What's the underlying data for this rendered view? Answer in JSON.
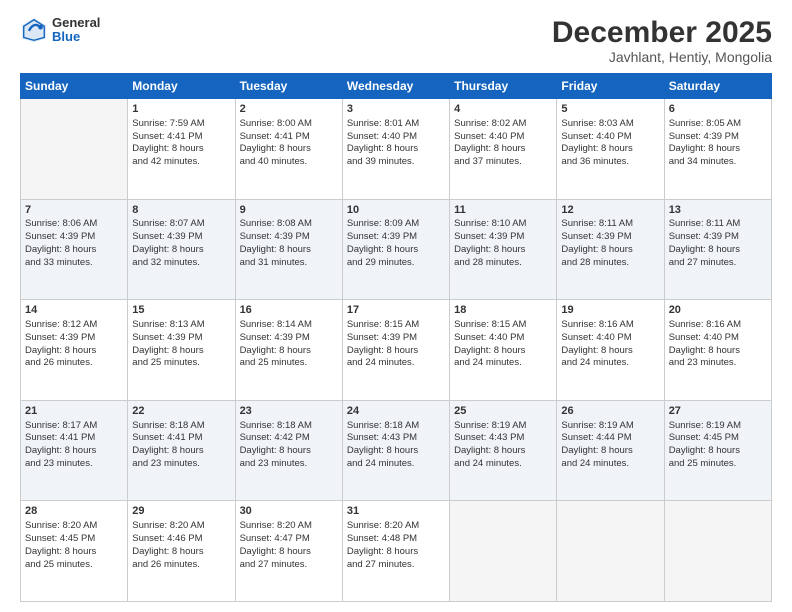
{
  "header": {
    "logo_general": "General",
    "logo_blue": "Blue",
    "month": "December 2025",
    "location": "Javhlant, Hentiy, Mongolia"
  },
  "days_of_week": [
    "Sunday",
    "Monday",
    "Tuesday",
    "Wednesday",
    "Thursday",
    "Friday",
    "Saturday"
  ],
  "weeks": [
    [
      {
        "day": "",
        "empty": true
      },
      {
        "day": "1",
        "sunrise": "Sunrise: 7:59 AM",
        "sunset": "Sunset: 4:41 PM",
        "daylight": "Daylight: 8 hours and 42 minutes."
      },
      {
        "day": "2",
        "sunrise": "Sunrise: 8:00 AM",
        "sunset": "Sunset: 4:41 PM",
        "daylight": "Daylight: 8 hours and 40 minutes."
      },
      {
        "day": "3",
        "sunrise": "Sunrise: 8:01 AM",
        "sunset": "Sunset: 4:40 PM",
        "daylight": "Daylight: 8 hours and 39 minutes."
      },
      {
        "day": "4",
        "sunrise": "Sunrise: 8:02 AM",
        "sunset": "Sunset: 4:40 PM",
        "daylight": "Daylight: 8 hours and 37 minutes."
      },
      {
        "day": "5",
        "sunrise": "Sunrise: 8:03 AM",
        "sunset": "Sunset: 4:40 PM",
        "daylight": "Daylight: 8 hours and 36 minutes."
      },
      {
        "day": "6",
        "sunrise": "Sunrise: 8:05 AM",
        "sunset": "Sunset: 4:39 PM",
        "daylight": "Daylight: 8 hours and 34 minutes."
      }
    ],
    [
      {
        "day": "7",
        "sunrise": "Sunrise: 8:06 AM",
        "sunset": "Sunset: 4:39 PM",
        "daylight": "Daylight: 8 hours and 33 minutes."
      },
      {
        "day": "8",
        "sunrise": "Sunrise: 8:07 AM",
        "sunset": "Sunset: 4:39 PM",
        "daylight": "Daylight: 8 hours and 32 minutes."
      },
      {
        "day": "9",
        "sunrise": "Sunrise: 8:08 AM",
        "sunset": "Sunset: 4:39 PM",
        "daylight": "Daylight: 8 hours and 31 minutes."
      },
      {
        "day": "10",
        "sunrise": "Sunrise: 8:09 AM",
        "sunset": "Sunset: 4:39 PM",
        "daylight": "Daylight: 8 hours and 29 minutes."
      },
      {
        "day": "11",
        "sunrise": "Sunrise: 8:10 AM",
        "sunset": "Sunset: 4:39 PM",
        "daylight": "Daylight: 8 hours and 28 minutes."
      },
      {
        "day": "12",
        "sunrise": "Sunrise: 8:11 AM",
        "sunset": "Sunset: 4:39 PM",
        "daylight": "Daylight: 8 hours and 28 minutes."
      },
      {
        "day": "13",
        "sunrise": "Sunrise: 8:11 AM",
        "sunset": "Sunset: 4:39 PM",
        "daylight": "Daylight: 8 hours and 27 minutes."
      }
    ],
    [
      {
        "day": "14",
        "sunrise": "Sunrise: 8:12 AM",
        "sunset": "Sunset: 4:39 PM",
        "daylight": "Daylight: 8 hours and 26 minutes."
      },
      {
        "day": "15",
        "sunrise": "Sunrise: 8:13 AM",
        "sunset": "Sunset: 4:39 PM",
        "daylight": "Daylight: 8 hours and 25 minutes."
      },
      {
        "day": "16",
        "sunrise": "Sunrise: 8:14 AM",
        "sunset": "Sunset: 4:39 PM",
        "daylight": "Daylight: 8 hours and 25 minutes."
      },
      {
        "day": "17",
        "sunrise": "Sunrise: 8:15 AM",
        "sunset": "Sunset: 4:39 PM",
        "daylight": "Daylight: 8 hours and 24 minutes."
      },
      {
        "day": "18",
        "sunrise": "Sunrise: 8:15 AM",
        "sunset": "Sunset: 4:40 PM",
        "daylight": "Daylight: 8 hours and 24 minutes."
      },
      {
        "day": "19",
        "sunrise": "Sunrise: 8:16 AM",
        "sunset": "Sunset: 4:40 PM",
        "daylight": "Daylight: 8 hours and 24 minutes."
      },
      {
        "day": "20",
        "sunrise": "Sunrise: 8:16 AM",
        "sunset": "Sunset: 4:40 PM",
        "daylight": "Daylight: 8 hours and 23 minutes."
      }
    ],
    [
      {
        "day": "21",
        "sunrise": "Sunrise: 8:17 AM",
        "sunset": "Sunset: 4:41 PM",
        "daylight": "Daylight: 8 hours and 23 minutes."
      },
      {
        "day": "22",
        "sunrise": "Sunrise: 8:18 AM",
        "sunset": "Sunset: 4:41 PM",
        "daylight": "Daylight: 8 hours and 23 minutes."
      },
      {
        "day": "23",
        "sunrise": "Sunrise: 8:18 AM",
        "sunset": "Sunset: 4:42 PM",
        "daylight": "Daylight: 8 hours and 23 minutes."
      },
      {
        "day": "24",
        "sunrise": "Sunrise: 8:18 AM",
        "sunset": "Sunset: 4:43 PM",
        "daylight": "Daylight: 8 hours and 24 minutes."
      },
      {
        "day": "25",
        "sunrise": "Sunrise: 8:19 AM",
        "sunset": "Sunset: 4:43 PM",
        "daylight": "Daylight: 8 hours and 24 minutes."
      },
      {
        "day": "26",
        "sunrise": "Sunrise: 8:19 AM",
        "sunset": "Sunset: 4:44 PM",
        "daylight": "Daylight: 8 hours and 24 minutes."
      },
      {
        "day": "27",
        "sunrise": "Sunrise: 8:19 AM",
        "sunset": "Sunset: 4:45 PM",
        "daylight": "Daylight: 8 hours and 25 minutes."
      }
    ],
    [
      {
        "day": "28",
        "sunrise": "Sunrise: 8:20 AM",
        "sunset": "Sunset: 4:45 PM",
        "daylight": "Daylight: 8 hours and 25 minutes."
      },
      {
        "day": "29",
        "sunrise": "Sunrise: 8:20 AM",
        "sunset": "Sunset: 4:46 PM",
        "daylight": "Daylight: 8 hours and 26 minutes."
      },
      {
        "day": "30",
        "sunrise": "Sunrise: 8:20 AM",
        "sunset": "Sunset: 4:47 PM",
        "daylight": "Daylight: 8 hours and 27 minutes."
      },
      {
        "day": "31",
        "sunrise": "Sunrise: 8:20 AM",
        "sunset": "Sunset: 4:48 PM",
        "daylight": "Daylight: 8 hours and 27 minutes."
      },
      {
        "day": "",
        "empty": true
      },
      {
        "day": "",
        "empty": true
      },
      {
        "day": "",
        "empty": true
      }
    ]
  ]
}
